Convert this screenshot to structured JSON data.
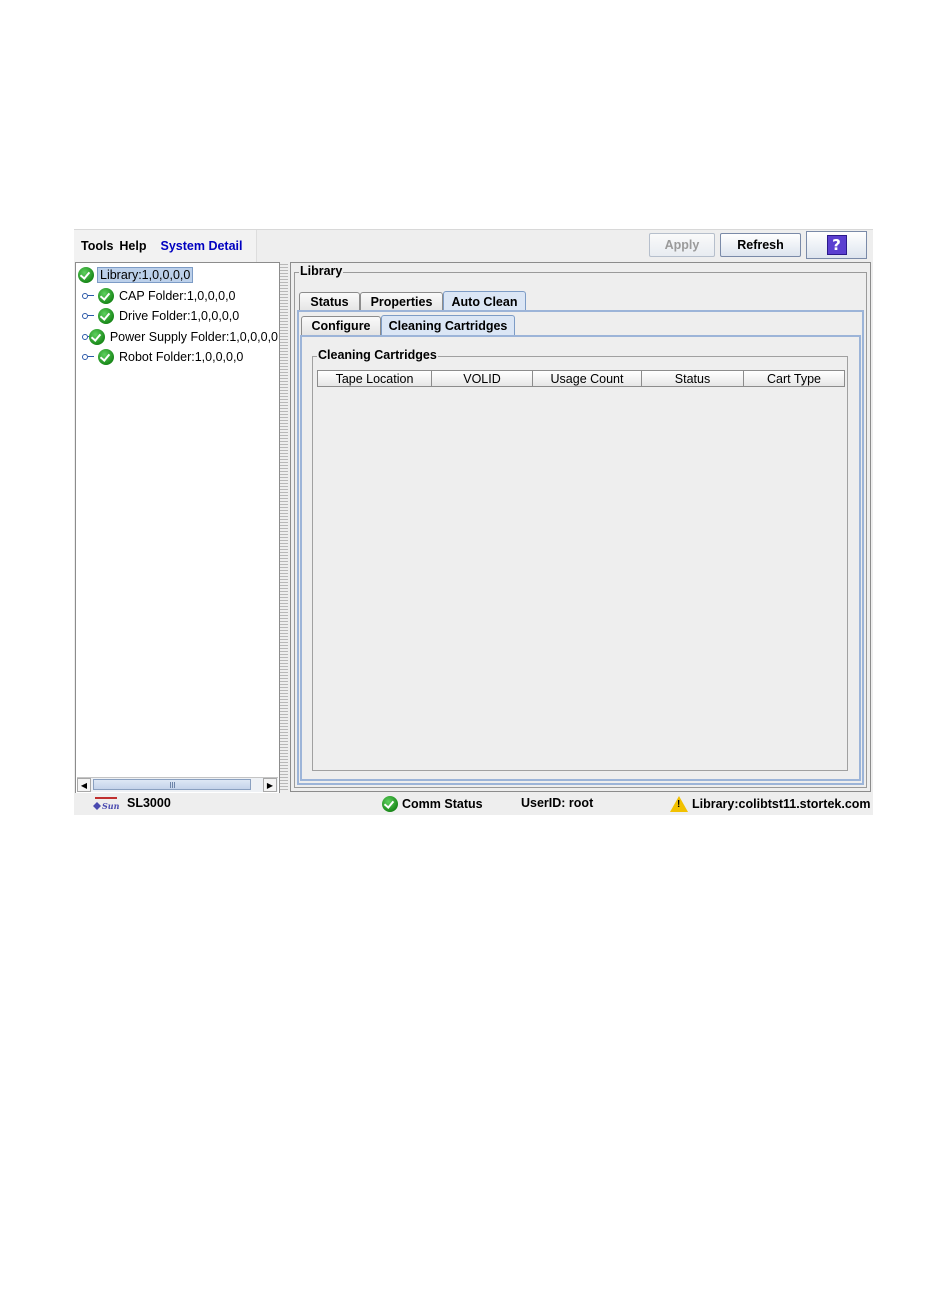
{
  "menu": {
    "items": [
      "Tools",
      "Help",
      "System Detail"
    ]
  },
  "toolbar": {
    "apply_label": "Apply",
    "refresh_label": "Refresh",
    "help_label": "?"
  },
  "tree": {
    "root": "Library:1,0,0,0,0",
    "children": [
      "CAP Folder:1,0,0,0,0",
      "Drive Folder:1,0,0,0,0",
      "Power Supply Folder:1,0,0,0,0",
      "Robot Folder:1,0,0,0,0"
    ]
  },
  "content": {
    "group_title": "Library",
    "tabs": [
      "Status",
      "Properties",
      "Auto Clean"
    ],
    "active_tab": "Auto Clean",
    "subtabs": [
      "Configure",
      "Cleaning Cartridges"
    ],
    "active_subtab": "Cleaning Cartridges",
    "cartridges_group_title": "Cleaning Cartridges",
    "table_columns": [
      "Tape Location",
      "VOLID",
      "Usage Count",
      "Status",
      "Cart Type"
    ],
    "table_rows": []
  },
  "statusbar": {
    "product": "SL3000",
    "comm_status": "Comm Status",
    "user": "UserID: root",
    "library": "Library:colibtst11.stortek.com"
  },
  "colors": {
    "menu_accent": "#0000c0",
    "ok_green": "#1a8a1a",
    "warn_yellow": "#f2c100",
    "tab_active": "#dbe6f5"
  }
}
